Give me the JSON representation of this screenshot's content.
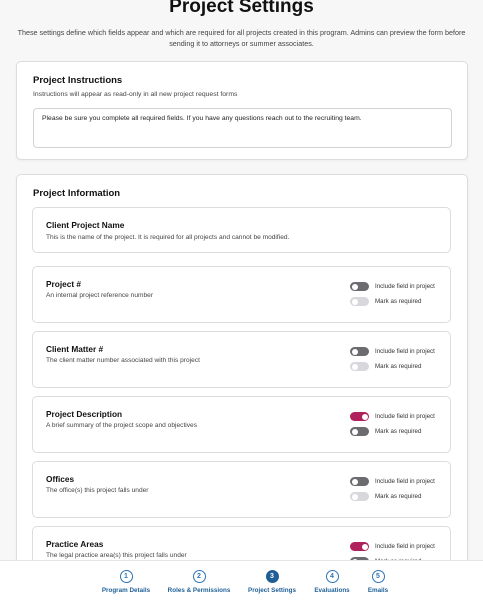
{
  "header": {
    "title": "Project Settings",
    "subtitle": "These settings define which fields appear and which are required for all projects created in this program. Admins can preview the form before sending it to attorneys or summer associates."
  },
  "instructions": {
    "heading": "Project Instructions",
    "subheading": "Instructions will appear as read-only in all new project request forms",
    "text": "Please be sure you complete all required fields.  If you have any questions reach out to the recruiting team."
  },
  "info": {
    "heading": "Project Information",
    "client_project": {
      "title": "Client Project Name",
      "desc": "This is the name of the project. It is required for all projects and cannot be modified."
    },
    "include_label": "Include field in project",
    "required_label": "Mark as required",
    "fields": [
      {
        "title": "Project #",
        "desc": "An internal project reference number",
        "include": false,
        "required": false
      },
      {
        "title": "Client Matter #",
        "desc": "The client matter number associated with this project",
        "include": false,
        "required": false
      },
      {
        "title": "Project Description",
        "desc": "A brief summary of the project scope and objectives",
        "include": true,
        "required": false
      },
      {
        "title": "Offices",
        "desc": "The office(s) this project falls under",
        "include": false,
        "required": false
      },
      {
        "title": "Practice Areas",
        "desc": "The legal practice area(s) this project falls under",
        "include": true,
        "required": false
      }
    ]
  },
  "colors": {
    "accent_on": "#b0205c",
    "toggle_off": "#6b6b70",
    "toggle_disabled": "#d8d8dc",
    "stepper": "#1f5f96"
  },
  "stepper": {
    "active_index": 2,
    "steps": [
      {
        "number": "1",
        "label": "Program Details"
      },
      {
        "number": "2",
        "label": "Roles & Permissions"
      },
      {
        "number": "3",
        "label": "Project Settings"
      },
      {
        "number": "4",
        "label": "Evaluations"
      },
      {
        "number": "5",
        "label": "Emails"
      }
    ]
  }
}
